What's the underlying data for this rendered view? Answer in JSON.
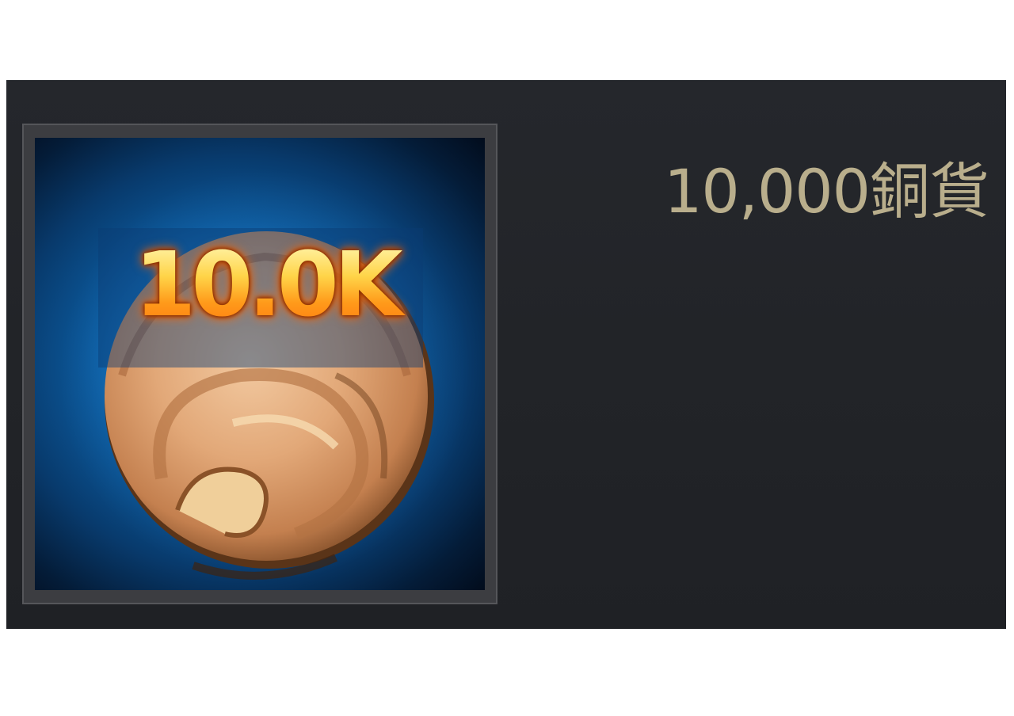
{
  "item": {
    "quantity_badge": "10.0K",
    "name": "10,000銅貨",
    "icon": "copper-coin-icon"
  },
  "colors": {
    "panel_background": "#222428",
    "item_name_text": "#b9ae8c",
    "quantity_text": "#ffb020",
    "icon_background": "#0b5494",
    "coin": "#d99a64"
  }
}
